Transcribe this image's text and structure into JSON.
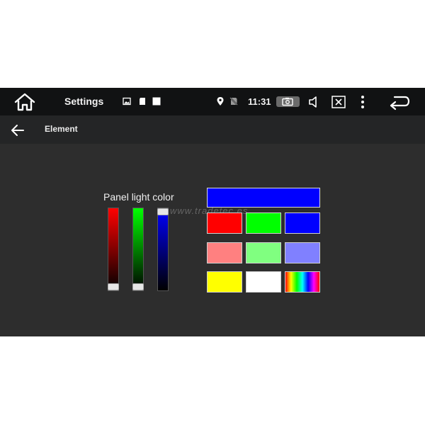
{
  "status_bar": {
    "app_title": "Settings",
    "time": "11:31",
    "icons": [
      "home-icon",
      "image-icon",
      "sd-card-icon",
      "square-icon",
      "location-icon",
      "no-sim-icon",
      "camera-icon",
      "volume-icon",
      "close-box-icon",
      "more-vert-icon",
      "back-arrow-icon"
    ]
  },
  "app_bar": {
    "title": "Element",
    "back_icon": "arrow-left-icon"
  },
  "panel": {
    "label": "Panel light color",
    "watermark": "www.tradetec.es",
    "sliders": [
      {
        "name": "red",
        "color": "#ff0000",
        "level": 0.0
      },
      {
        "name": "green",
        "color": "#00ff00",
        "level": 0.0
      },
      {
        "name": "blue",
        "color": "#0000ff",
        "level": 1.0
      }
    ],
    "preview_color": "#0000ff",
    "swatches": [
      {
        "name": "red",
        "color": "#ff0000"
      },
      {
        "name": "green",
        "color": "#00ff00"
      },
      {
        "name": "blue",
        "color": "#0000ff"
      },
      {
        "name": "light-red",
        "color": "#ff8080"
      },
      {
        "name": "light-green",
        "color": "#80ff80"
      },
      {
        "name": "light-blue",
        "color": "#8080ff"
      },
      {
        "name": "yellow",
        "color": "#ffff00"
      },
      {
        "name": "white",
        "color": "#ffffff"
      },
      {
        "name": "rainbow",
        "color": "rainbow"
      }
    ]
  }
}
